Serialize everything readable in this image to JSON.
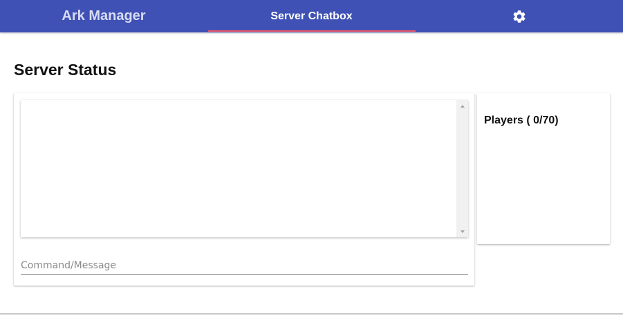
{
  "app": {
    "brand": "Ark Manager",
    "active_tab": "Server Chatbox",
    "settings_icon": "gear-icon",
    "colors": {
      "header": "#3f51b5",
      "tab_indicator": "#ef5a6a",
      "brand_text": "#d7dcf2"
    }
  },
  "main": {
    "title": "Server Status",
    "chat": {
      "messages": [],
      "command_placeholder": "Command/Message",
      "command_value": ""
    },
    "players": {
      "title": "Players ( 0/70)",
      "list": []
    }
  }
}
